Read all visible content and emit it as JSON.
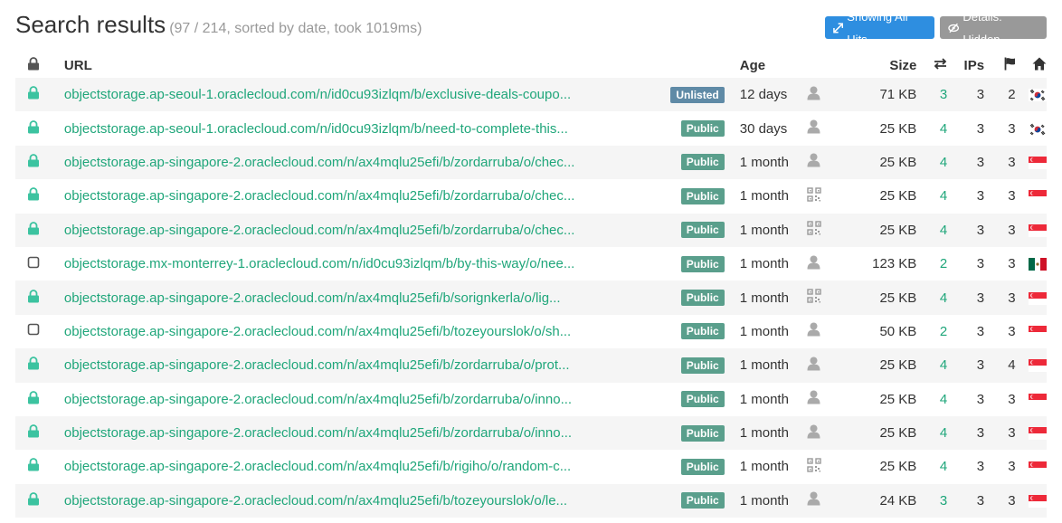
{
  "header": {
    "title": "Search results",
    "subtitle": "(97 / 214, sorted by date, took 1019ms)",
    "showing_hits_label": "Showing All Hits",
    "details_label": "Details: Hidden"
  },
  "columns": {
    "url": "URL",
    "age": "Age",
    "size": "Size",
    "ips": "IPs"
  },
  "colors": {
    "link": "#1fa67a",
    "public_badge": "#5a9f8c",
    "unlisted_badge": "#5f8aa6",
    "btn_hits": "#2e8ee0",
    "btn_details": "#999999"
  },
  "rows": [
    {
      "secure": true,
      "url": "objectstorage.ap-seoul-1.oraclecloud.com/n/id0cu93izlqm/b/exclusive-deals-coupo...",
      "visibility": "Unlisted",
      "age": "12 days",
      "type_icon": "user-icon",
      "size": "71 KB",
      "hits": "3",
      "ips": "3",
      "flags": "2",
      "country": "kr"
    },
    {
      "secure": true,
      "url": "objectstorage.ap-seoul-1.oraclecloud.com/n/id0cu93izlqm/b/need-to-complete-this...",
      "visibility": "Public",
      "age": "30 days",
      "type_icon": "user-icon",
      "size": "25 KB",
      "hits": "4",
      "ips": "3",
      "flags": "3",
      "country": "kr"
    },
    {
      "secure": true,
      "url": "objectstorage.ap-singapore-2.oraclecloud.com/n/ax4mqlu25efi/b/zordarruba/o/chec...",
      "visibility": "Public",
      "age": "1 month",
      "type_icon": "user-icon",
      "size": "25 KB",
      "hits": "4",
      "ips": "3",
      "flags": "3",
      "country": "sg"
    },
    {
      "secure": true,
      "url": "objectstorage.ap-singapore-2.oraclecloud.com/n/ax4mqlu25efi/b/zordarruba/o/chec...",
      "visibility": "Public",
      "age": "1 month",
      "type_icon": "qr-icon",
      "size": "25 KB",
      "hits": "4",
      "ips": "3",
      "flags": "3",
      "country": "sg"
    },
    {
      "secure": true,
      "url": "objectstorage.ap-singapore-2.oraclecloud.com/n/ax4mqlu25efi/b/zordarruba/o/chec...",
      "visibility": "Public",
      "age": "1 month",
      "type_icon": "qr-icon",
      "size": "25 KB",
      "hits": "4",
      "ips": "3",
      "flags": "3",
      "country": "sg"
    },
    {
      "secure": false,
      "url": "objectstorage.mx-monterrey-1.oraclecloud.com/n/id0cu93izlqm/b/by-this-way/o/nee...",
      "visibility": "Public",
      "age": "1 month",
      "type_icon": "user-icon",
      "size": "123 KB",
      "hits": "2",
      "ips": "3",
      "flags": "3",
      "country": "mx"
    },
    {
      "secure": true,
      "url": "objectstorage.ap-singapore-2.oraclecloud.com/n/ax4mqlu25efi/b/sorignkerla/o/lig...",
      "visibility": "Public",
      "age": "1 month",
      "type_icon": "qr-icon",
      "size": "25 KB",
      "hits": "4",
      "ips": "3",
      "flags": "3",
      "country": "sg"
    },
    {
      "secure": false,
      "url": "objectstorage.ap-singapore-2.oraclecloud.com/n/ax4mqlu25efi/b/tozeyourslok/o/sh...",
      "visibility": "Public",
      "age": "1 month",
      "type_icon": "user-icon",
      "size": "50 KB",
      "hits": "2",
      "ips": "3",
      "flags": "3",
      "country": "sg"
    },
    {
      "secure": true,
      "url": "objectstorage.ap-singapore-2.oraclecloud.com/n/ax4mqlu25efi/b/zordarruba/o/prot...",
      "visibility": "Public",
      "age": "1 month",
      "type_icon": "user-icon",
      "size": "25 KB",
      "hits": "4",
      "ips": "3",
      "flags": "4",
      "country": "sg"
    },
    {
      "secure": true,
      "url": "objectstorage.ap-singapore-2.oraclecloud.com/n/ax4mqlu25efi/b/zordarruba/o/inno...",
      "visibility": "Public",
      "age": "1 month",
      "type_icon": "user-icon",
      "size": "25 KB",
      "hits": "4",
      "ips": "3",
      "flags": "3",
      "country": "sg"
    },
    {
      "secure": true,
      "url": "objectstorage.ap-singapore-2.oraclecloud.com/n/ax4mqlu25efi/b/zordarruba/o/inno...",
      "visibility": "Public",
      "age": "1 month",
      "type_icon": "user-icon",
      "size": "25 KB",
      "hits": "4",
      "ips": "3",
      "flags": "3",
      "country": "sg"
    },
    {
      "secure": true,
      "url": "objectstorage.ap-singapore-2.oraclecloud.com/n/ax4mqlu25efi/b/rigiho/o/random-c...",
      "visibility": "Public",
      "age": "1 month",
      "type_icon": "qr-icon",
      "size": "25 KB",
      "hits": "4",
      "ips": "3",
      "flags": "3",
      "country": "sg"
    },
    {
      "secure": true,
      "url": "objectstorage.ap-singapore-2.oraclecloud.com/n/ax4mqlu25efi/b/tozeyourslok/o/le...",
      "visibility": "Public",
      "age": "1 month",
      "type_icon": "user-icon",
      "size": "24 KB",
      "hits": "3",
      "ips": "3",
      "flags": "3",
      "country": "sg"
    }
  ]
}
